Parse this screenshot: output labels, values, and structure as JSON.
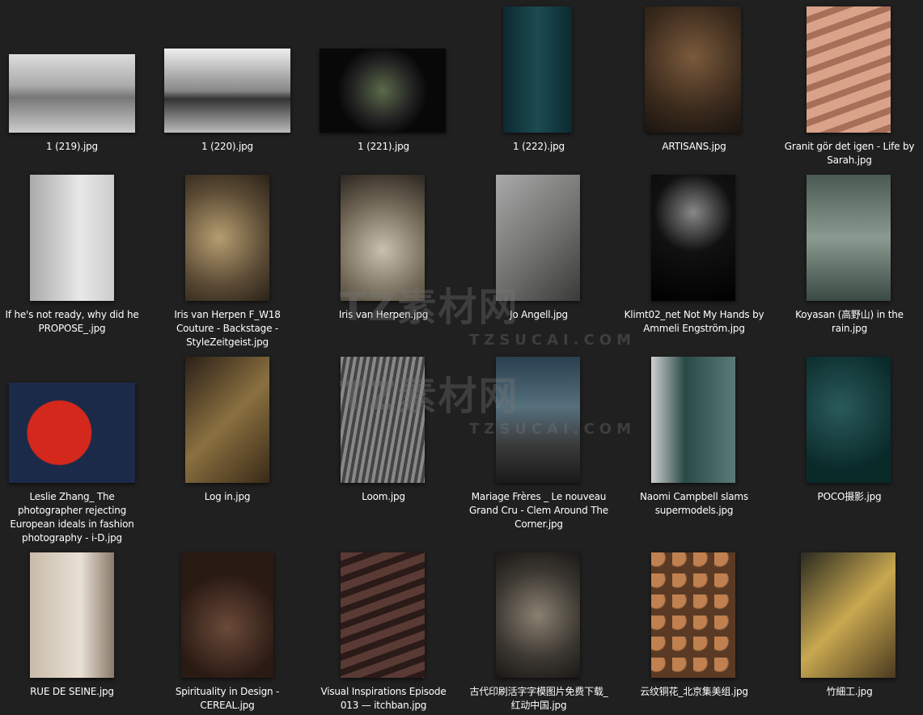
{
  "files": [
    {
      "name": "1 (219).jpg"
    },
    {
      "name": "1 (220).jpg"
    },
    {
      "name": "1 (221).jpg"
    },
    {
      "name": "1 (222).jpg"
    },
    {
      "name": "ARTISANS.jpg"
    },
    {
      "name": "Granit gör det igen - Life by Sarah.jpg"
    },
    {
      "name": "If he's not ready, why did he PROPOSE_.jpg"
    },
    {
      "name": "Iris van Herpen F_W18 Couture - Backstage - StyleZeitgeist.jpg"
    },
    {
      "name": "Iris van Herpen.jpg"
    },
    {
      "name": "Jo Angell.jpg"
    },
    {
      "name": "Klimt02_net Not My Hands by Ammeli Engström.jpg"
    },
    {
      "name": "Koyasan (高野山) in the rain.jpg"
    },
    {
      "name": "Leslie Zhang_ The photographer rejecting European ideals in fashion photography - i-D.jpg"
    },
    {
      "name": "Log in.jpg"
    },
    {
      "name": "Loom.jpg"
    },
    {
      "name": "Mariage Frères _ Le nouveau Grand Cru - Clem Around The Corner.jpg"
    },
    {
      "name": "Naomi Campbell slams supermodels.jpg"
    },
    {
      "name": "POCO摄影.jpg"
    },
    {
      "name": "RUE DE SEINE.jpg"
    },
    {
      "name": "Spirituality in Design - CEREAL.jpg"
    },
    {
      "name": "Visual Inspirations Episode 013 — itchban.jpg"
    },
    {
      "name": "古代印刷活字字模图片免费下载_红动中国.jpg"
    },
    {
      "name": "云纹铜花_北京集美组.jpg"
    },
    {
      "name": "竹細工.jpg"
    }
  ],
  "watermark": {
    "logo": "TZ素材网",
    "domain": "TZSUCAI.COM"
  }
}
